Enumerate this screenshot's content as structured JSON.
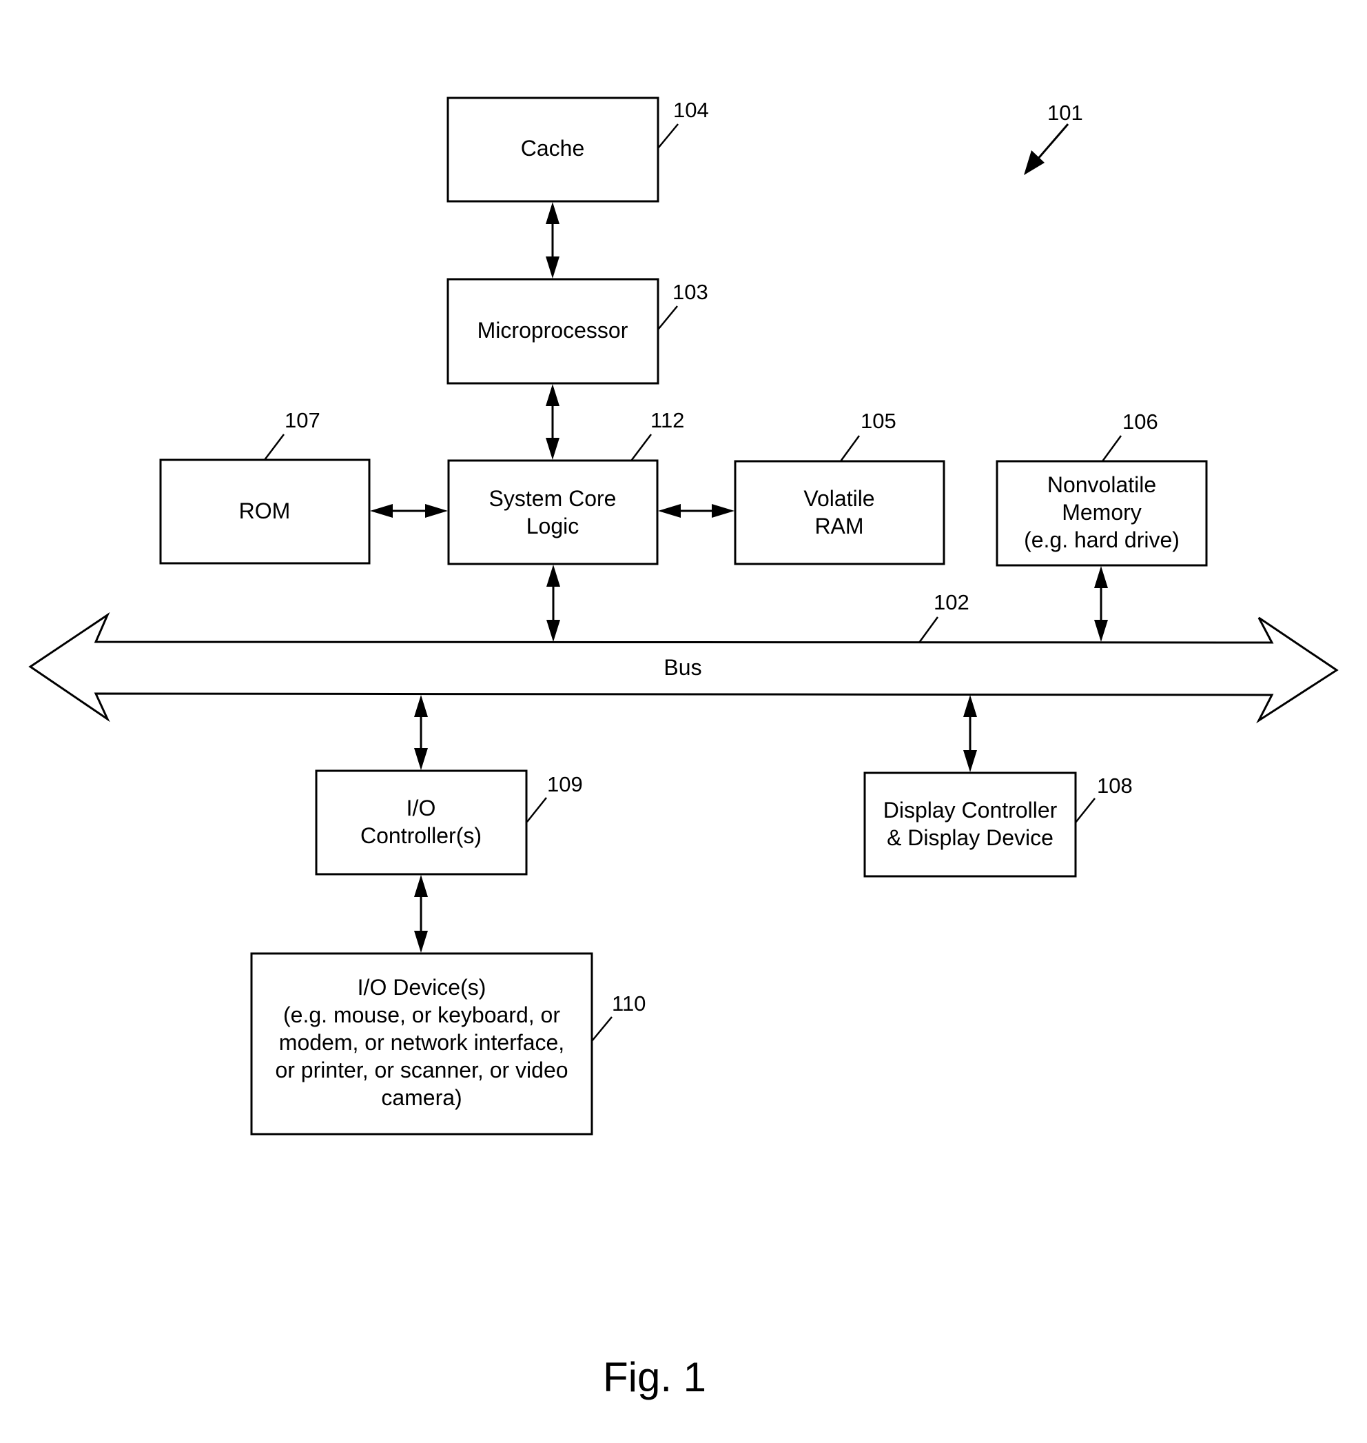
{
  "figure": {
    "caption": "Fig. 1",
    "system_ref": "101"
  },
  "components": {
    "cache": {
      "lines": [
        "Cache"
      ],
      "ref": "104"
    },
    "microprocessor": {
      "lines": [
        "Microprocessor"
      ],
      "ref": "103"
    },
    "rom": {
      "lines": [
        "ROM"
      ],
      "ref": "107"
    },
    "system_core_logic": {
      "lines": [
        "System Core",
        "Logic"
      ],
      "ref": "112"
    },
    "volatile_ram": {
      "lines": [
        "Volatile",
        "RAM"
      ],
      "ref": "105"
    },
    "nonvolatile_memory": {
      "lines": [
        "Nonvolatile",
        "Memory",
        "(e.g. hard drive)"
      ],
      "ref": "106"
    },
    "bus": {
      "lines": [
        "Bus"
      ],
      "ref": "102"
    },
    "io_controller": {
      "lines": [
        "I/O",
        "Controller(s)"
      ],
      "ref": "109"
    },
    "display": {
      "lines": [
        "Display Controller",
        "& Display Device"
      ],
      "ref": "108"
    },
    "io_devices": {
      "lines": [
        "I/O Device(s)",
        "(e.g. mouse, or keyboard, or",
        "modem, or network interface,",
        "or printer, or scanner, or video",
        "camera)"
      ],
      "ref": "110"
    }
  },
  "connections": [
    {
      "from": "cache",
      "to": "microprocessor",
      "type": "bidirectional"
    },
    {
      "from": "microprocessor",
      "to": "system_core_logic",
      "type": "bidirectional"
    },
    {
      "from": "rom",
      "to": "system_core_logic",
      "type": "bidirectional"
    },
    {
      "from": "system_core_logic",
      "to": "volatile_ram",
      "type": "bidirectional"
    },
    {
      "from": "system_core_logic",
      "to": "bus",
      "type": "bidirectional"
    },
    {
      "from": "nonvolatile_memory",
      "to": "bus",
      "type": "bidirectional"
    },
    {
      "from": "bus",
      "to": "io_controller",
      "type": "bidirectional"
    },
    {
      "from": "bus",
      "to": "display",
      "type": "bidirectional"
    },
    {
      "from": "io_controller",
      "to": "io_devices",
      "type": "bidirectional"
    }
  ]
}
